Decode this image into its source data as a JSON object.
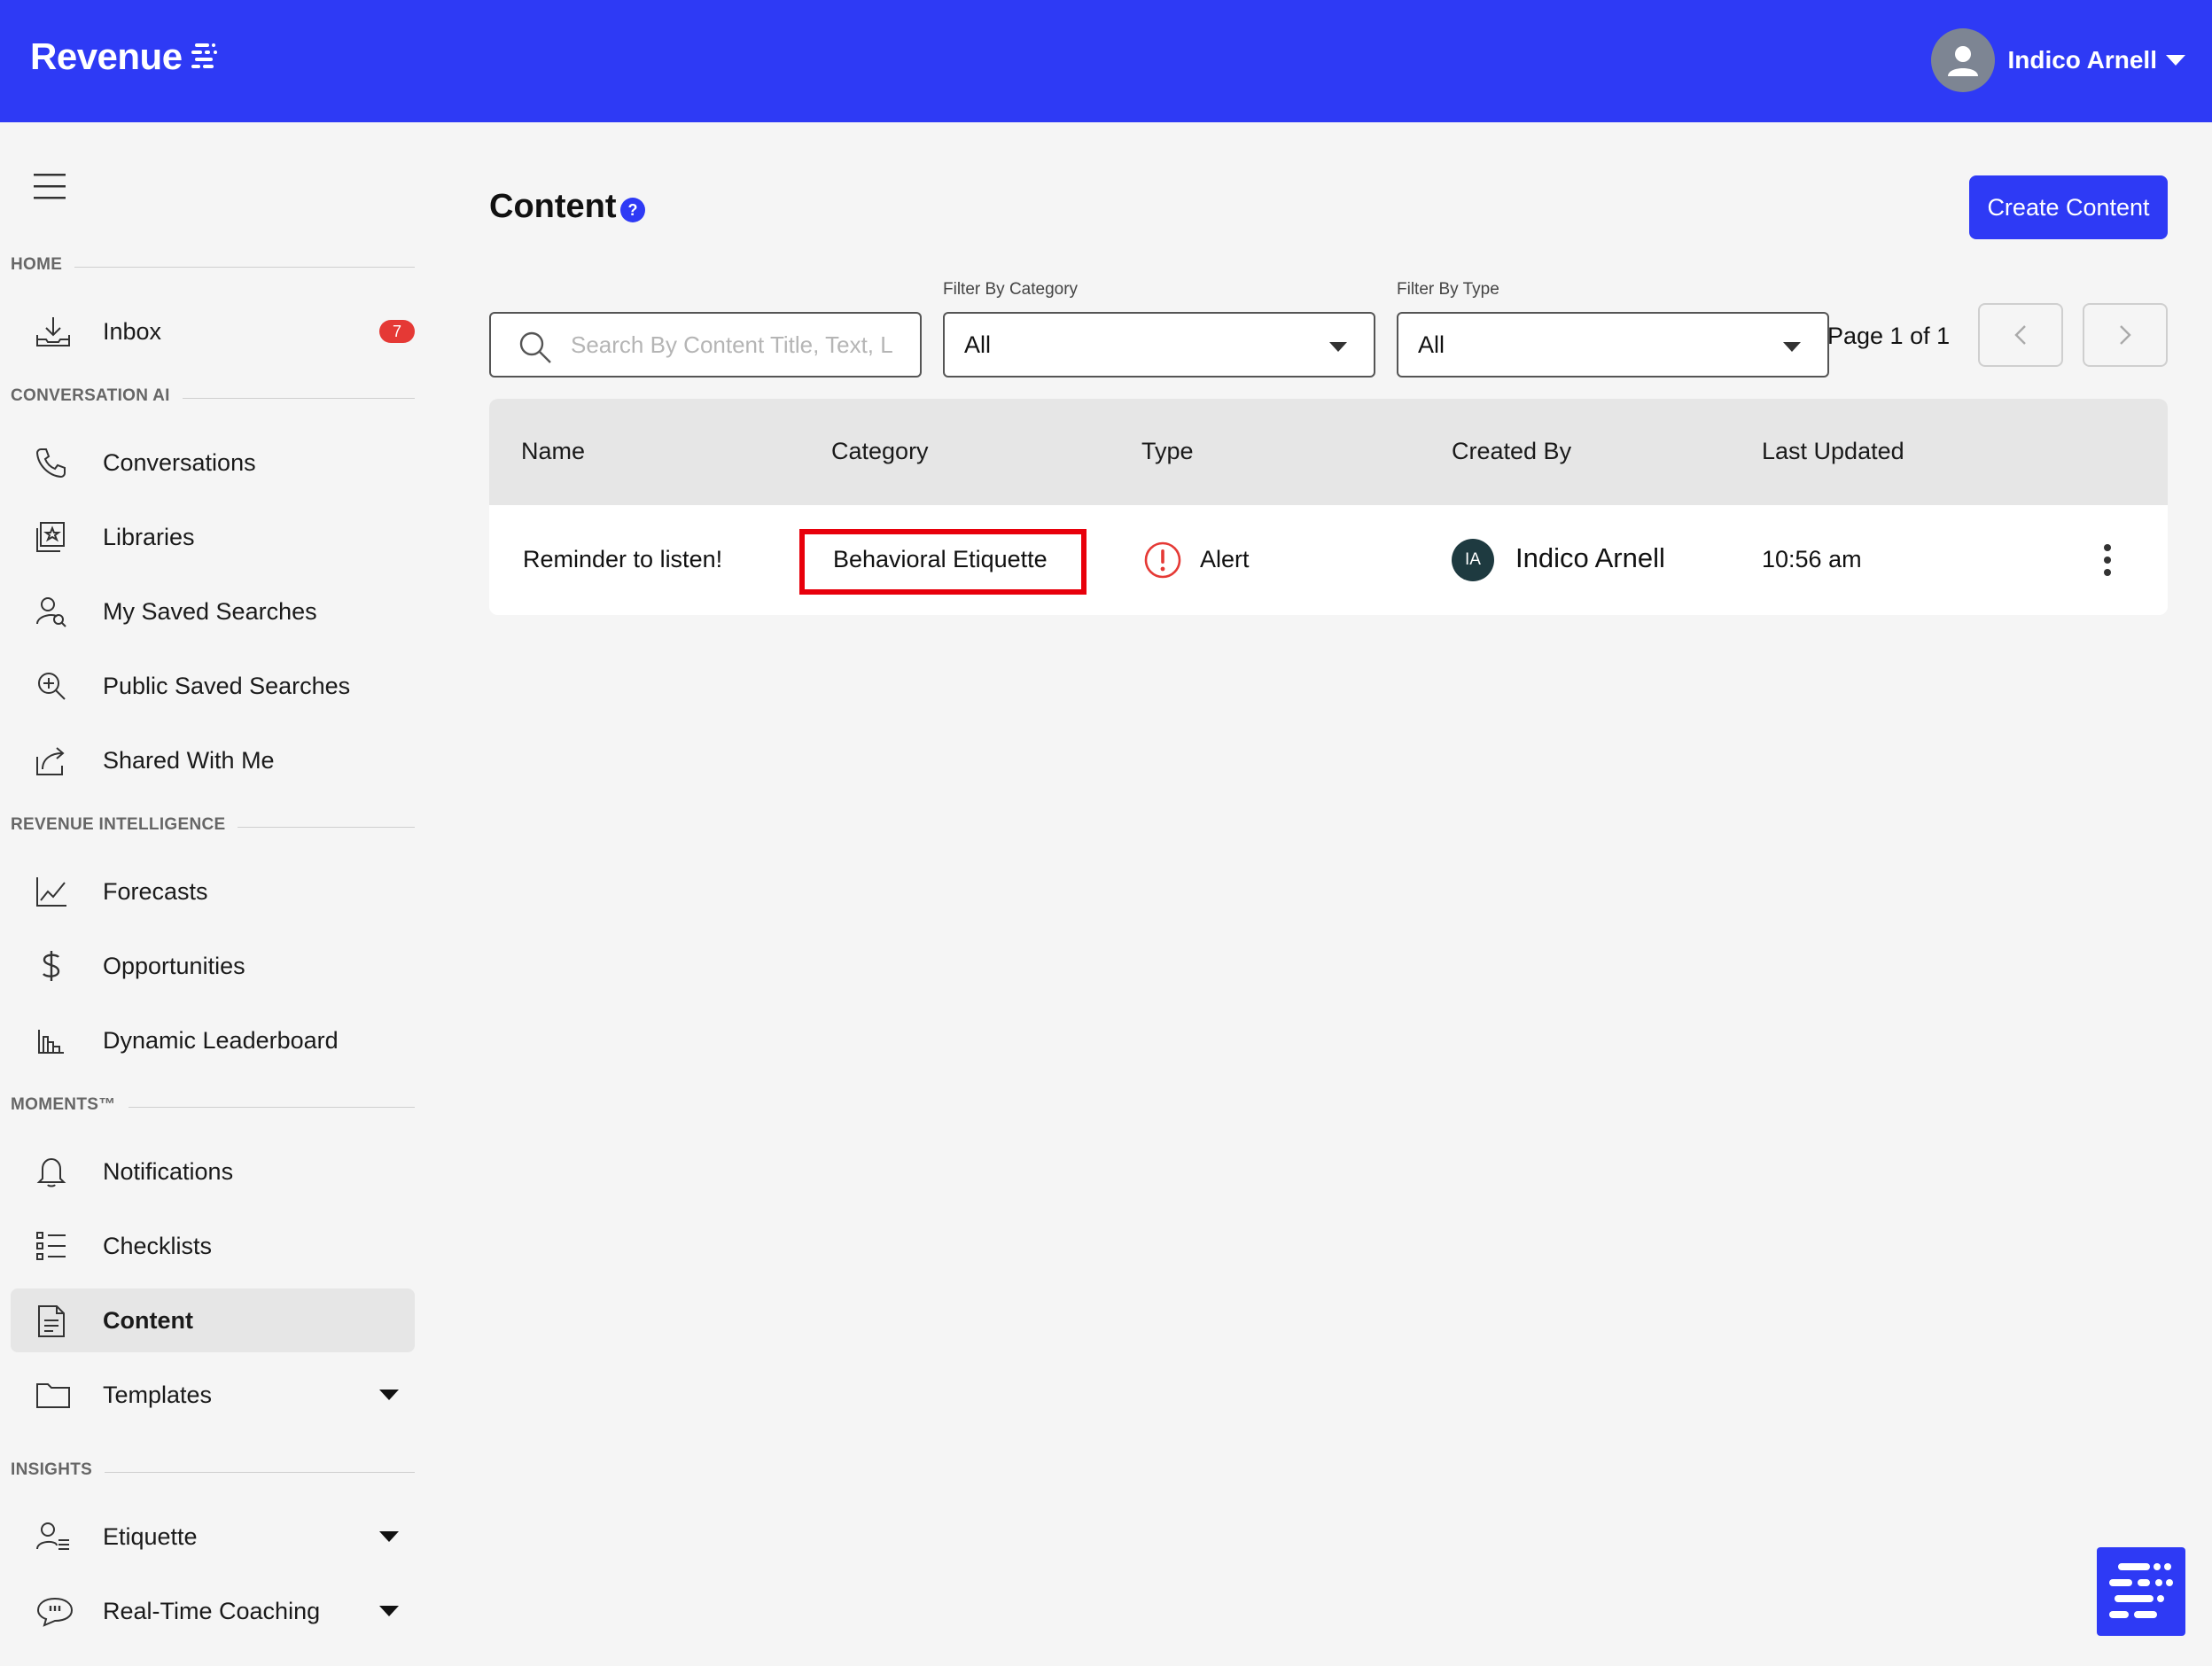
{
  "app": {
    "brand": "Revenue"
  },
  "user": {
    "name": "Indico Arnell"
  },
  "sidebar": {
    "sections": [
      {
        "title": "HOME"
      },
      {
        "title": "CONVERSATION AI"
      },
      {
        "title": "REVENUE INTELLIGENCE"
      },
      {
        "title": "MOMENTS™"
      },
      {
        "title": "INSIGHTS"
      }
    ],
    "items": [
      {
        "label": "Inbox",
        "icon": "inbox-icon",
        "badge": "7"
      },
      {
        "label": "Conversations",
        "icon": "phone-icon"
      },
      {
        "label": "Libraries",
        "icon": "library-icon"
      },
      {
        "label": "My Saved Searches",
        "icon": "user-search-icon"
      },
      {
        "label": "Public Saved Searches",
        "icon": "zoom-plus-icon"
      },
      {
        "label": "Shared With Me",
        "icon": "share-icon"
      },
      {
        "label": "Forecasts",
        "icon": "line-chart-icon"
      },
      {
        "label": "Opportunities",
        "icon": "dollar-icon"
      },
      {
        "label": "Dynamic Leaderboard",
        "icon": "bar-chart-icon"
      },
      {
        "label": "Notifications",
        "icon": "bell-icon"
      },
      {
        "label": "Checklists",
        "icon": "checklist-icon"
      },
      {
        "label": "Content",
        "icon": "document-icon",
        "active": true
      },
      {
        "label": "Templates",
        "icon": "folder-icon",
        "expandable": true
      },
      {
        "label": "Etiquette",
        "icon": "user-lines-icon",
        "expandable": true
      },
      {
        "label": "Real-Time Coaching",
        "icon": "chat-bubble-icon",
        "expandable": true
      }
    ]
  },
  "main": {
    "title": "Content",
    "create_button": "Create Content",
    "search": {
      "placeholder": "Search By Content Title, Text, L",
      "value": ""
    },
    "filter_category": {
      "label": "Filter By Category",
      "value": "All"
    },
    "filter_type": {
      "label": "Filter By Type",
      "value": "All"
    },
    "pagination": {
      "text": "Page 1 of 1"
    },
    "table": {
      "columns": [
        "Name",
        "Category",
        "Type",
        "Created By",
        "Last Updated"
      ],
      "rows": [
        {
          "name": "Reminder to listen!",
          "category": "Behavioral Etiquette",
          "type": "Alert",
          "created_by_initials": "IA",
          "created_by": "Indico Arnell",
          "last_updated": "10:56 am"
        }
      ]
    }
  },
  "colors": {
    "brand": "#2e3af5",
    "badge": "#e53935",
    "highlight": "#e8000b",
    "alert": "#e53935"
  }
}
